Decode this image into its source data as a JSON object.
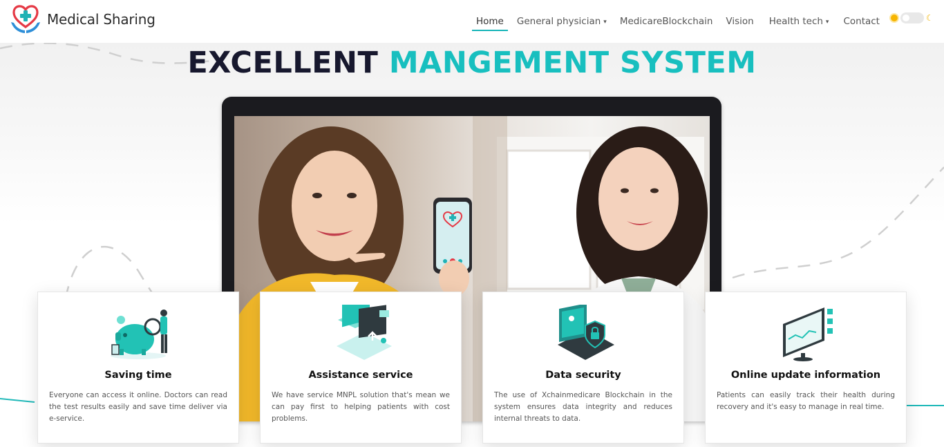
{
  "brand": {
    "name": "Medical Sharing",
    "logo_icon": "heart-hands-cross-icon"
  },
  "nav": {
    "items": [
      {
        "label": "Home",
        "active": true,
        "dropdown": false
      },
      {
        "label": "General physician",
        "active": false,
        "dropdown": true
      },
      {
        "label": "MedicareBlockchain",
        "active": false,
        "dropdown": false
      },
      {
        "label": "Vision",
        "active": false,
        "dropdown": false
      },
      {
        "label": "Health tech",
        "active": false,
        "dropdown": true
      },
      {
        "label": "Contact",
        "active": false,
        "dropdown": false
      }
    ],
    "caret": "▾",
    "theme_toggle": {
      "light_icon": "sun-icon",
      "dark_icon": "moon-icon",
      "state": "light"
    }
  },
  "hero": {
    "title_dark": "EXCELLENT",
    "title_teal": "MANGEMENT SYSTEM"
  },
  "features": [
    {
      "title": "Saving time",
      "text": "Everyone can access it online. Doctors can read the test results easily and save time deliver via e-service.",
      "icon": "piggy-bank-icon"
    },
    {
      "title": "Assistance service",
      "text": "We have service MNPL solution that's mean we can pay first to helping patients with cost problems.",
      "icon": "folder-upload-icon"
    },
    {
      "title": "Data security",
      "text": "The use of Xchainmedicare Blockchain in the system ensures data integrity and reduces internal threats to data.",
      "icon": "laptop-shield-lock-icon"
    },
    {
      "title": "Online update information",
      "text": "Patients can easily track their health during recovery and it's easy to manage in real time.",
      "icon": "monitor-dashboard-icon"
    }
  ],
  "colors": {
    "accent": "#18bfbf",
    "title_dark": "#17182e",
    "nav_text": "#555555"
  }
}
